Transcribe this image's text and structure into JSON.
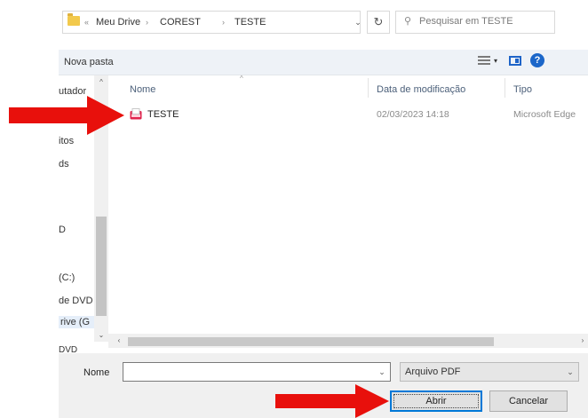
{
  "address_bar": {
    "crumbs": [
      "«",
      "Meu Drive",
      "›",
      "COREST",
      "›",
      "TESTE"
    ],
    "dropdown_glyph": "⌄",
    "refresh_glyph": "↻",
    "search_placeholder": "Pesquisar em TESTE",
    "search_glyph": "⚲"
  },
  "toolbar": {
    "new_folder_label": "Nova pasta",
    "help_glyph": "?",
    "views_dropdown_glyph": "▾"
  },
  "nav_pane": {
    "items": [
      {
        "label": "utador",
        "selected": false
      },
      {
        "label": "itos",
        "selected": false
      },
      {
        "label": "ds",
        "selected": false
      },
      {
        "label": "D",
        "selected": false
      },
      {
        "label": "(C:)",
        "selected": false
      },
      {
        "label": "de DVD",
        "selected": false
      },
      {
        "label": "rive (G",
        "selected": true
      }
    ],
    "bottom_label": "DVD",
    "scroll_up_glyph": "^",
    "scroll_down_glyph": "⌄"
  },
  "file_list": {
    "columns": [
      "Nome",
      "Data de modificação",
      "Tipo"
    ],
    "sort_glyph": "^",
    "rows": [
      {
        "name": "TESTE",
        "modified": "02/03/2023 14:18",
        "type": "Microsoft Edge",
        "icon": "pdf-file-icon"
      }
    ]
  },
  "h_scroll": {
    "left_glyph": "‹",
    "right_glyph": "›"
  },
  "footer": {
    "file_name_label": "Nome",
    "file_name_value": "",
    "file_type_filter": "Arquivo PDF",
    "open_button": "Abrir",
    "cancel_button": "Cancelar",
    "dropdown_glyph": "⌄"
  },
  "colors": {
    "annotation_arrow": "#e8100c",
    "accent": "#0078d7",
    "help": "#1b66c9",
    "folder": "#f2c94c"
  }
}
